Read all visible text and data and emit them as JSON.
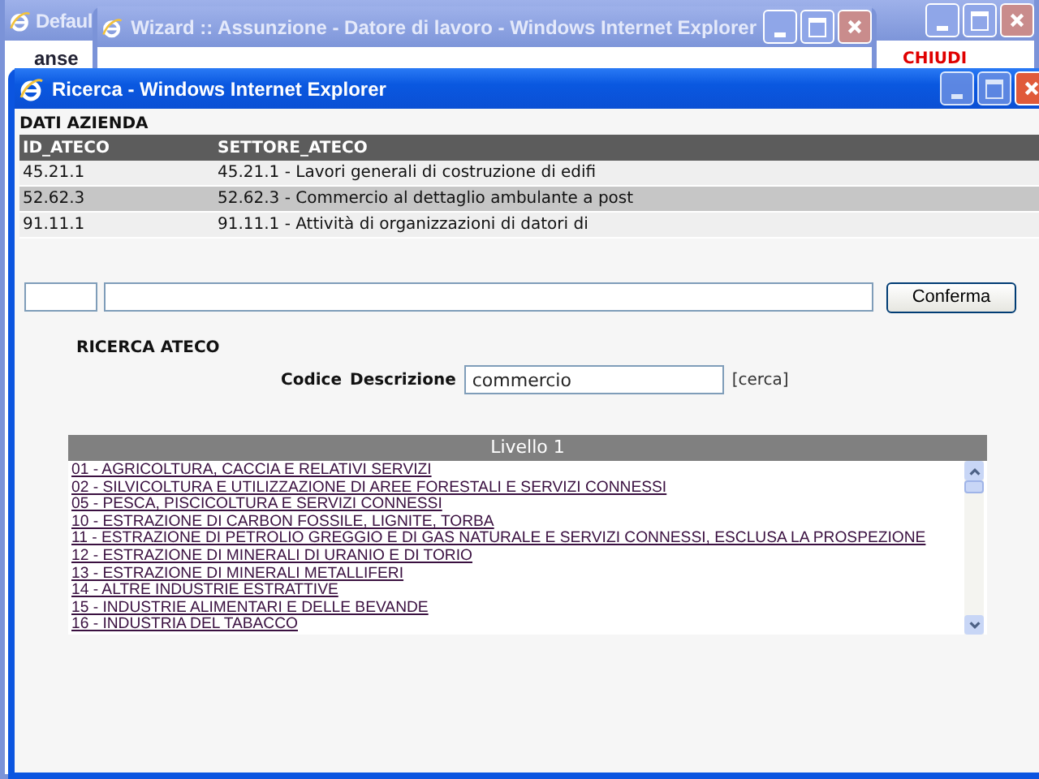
{
  "desktop_window": {
    "title": "Defaul",
    "logo_text": "anse",
    "link": "CHIUDI"
  },
  "wizard_window": {
    "title": "Wizard :: Assunzione - Datore di lavoro - Windows Internet Explorer"
  },
  "window": {
    "title": "Ricerca - Windows Internet Explorer"
  },
  "company": {
    "title": "DATI AZIENDA",
    "columns": [
      "ID_ATECO",
      "SETTORE_ATECO"
    ],
    "rows": [
      {
        "cells": [
          "45.21.1",
          "45.21.1 - Lavori generali di costruzione di edifi"
        ],
        "selected": false
      },
      {
        "cells": [
          "52.62.3",
          "52.62.3 - Commercio al dettaglio ambulante a post"
        ],
        "selected": true
      },
      {
        "cells": [
          "91.11.1",
          "91.11.1 - Attività di organizzazioni di datori di"
        ],
        "selected": false
      }
    ]
  },
  "confirm_button": "Conferma",
  "search": {
    "title": "RICERCA ATECO",
    "labels": [
      "Codice",
      "Descrizione"
    ],
    "value": "commercio",
    "link": "[cerca]"
  },
  "levels": {
    "title": "Livello 1",
    "items": [
      "01 - AGRICOLTURA, CACCIA E RELATIVI SERVIZI",
      "02 - SILVICOLTURA E UTILIZZAZIONE DI AREE FORESTALI E SERVIZI CONNESSI",
      "05 - PESCA, PISCICOLTURA E SERVIZI CONNESSI",
      "10 - ESTRAZIONE DI CARBON FOSSILE, LIGNITE, TORBA",
      "11 - ESTRAZIONE DI PETROLIO GREGGIO E DI GAS NATURALE E SERVIZI CONNESSI, ESCLUSA LA PROSPEZIONE",
      "12 - ESTRAZIONE DI MINERALI DI URANIO E DI TORIO",
      "13 - ESTRAZIONE DI MINERALI METALLIFERI",
      "14 - ALTRE INDUSTRIE ESTRATTIVE",
      "15 - INDUSTRIE ALIMENTARI E DELLE BEVANDE",
      "16 - INDUSTRIA DEL TABACCO"
    ]
  }
}
